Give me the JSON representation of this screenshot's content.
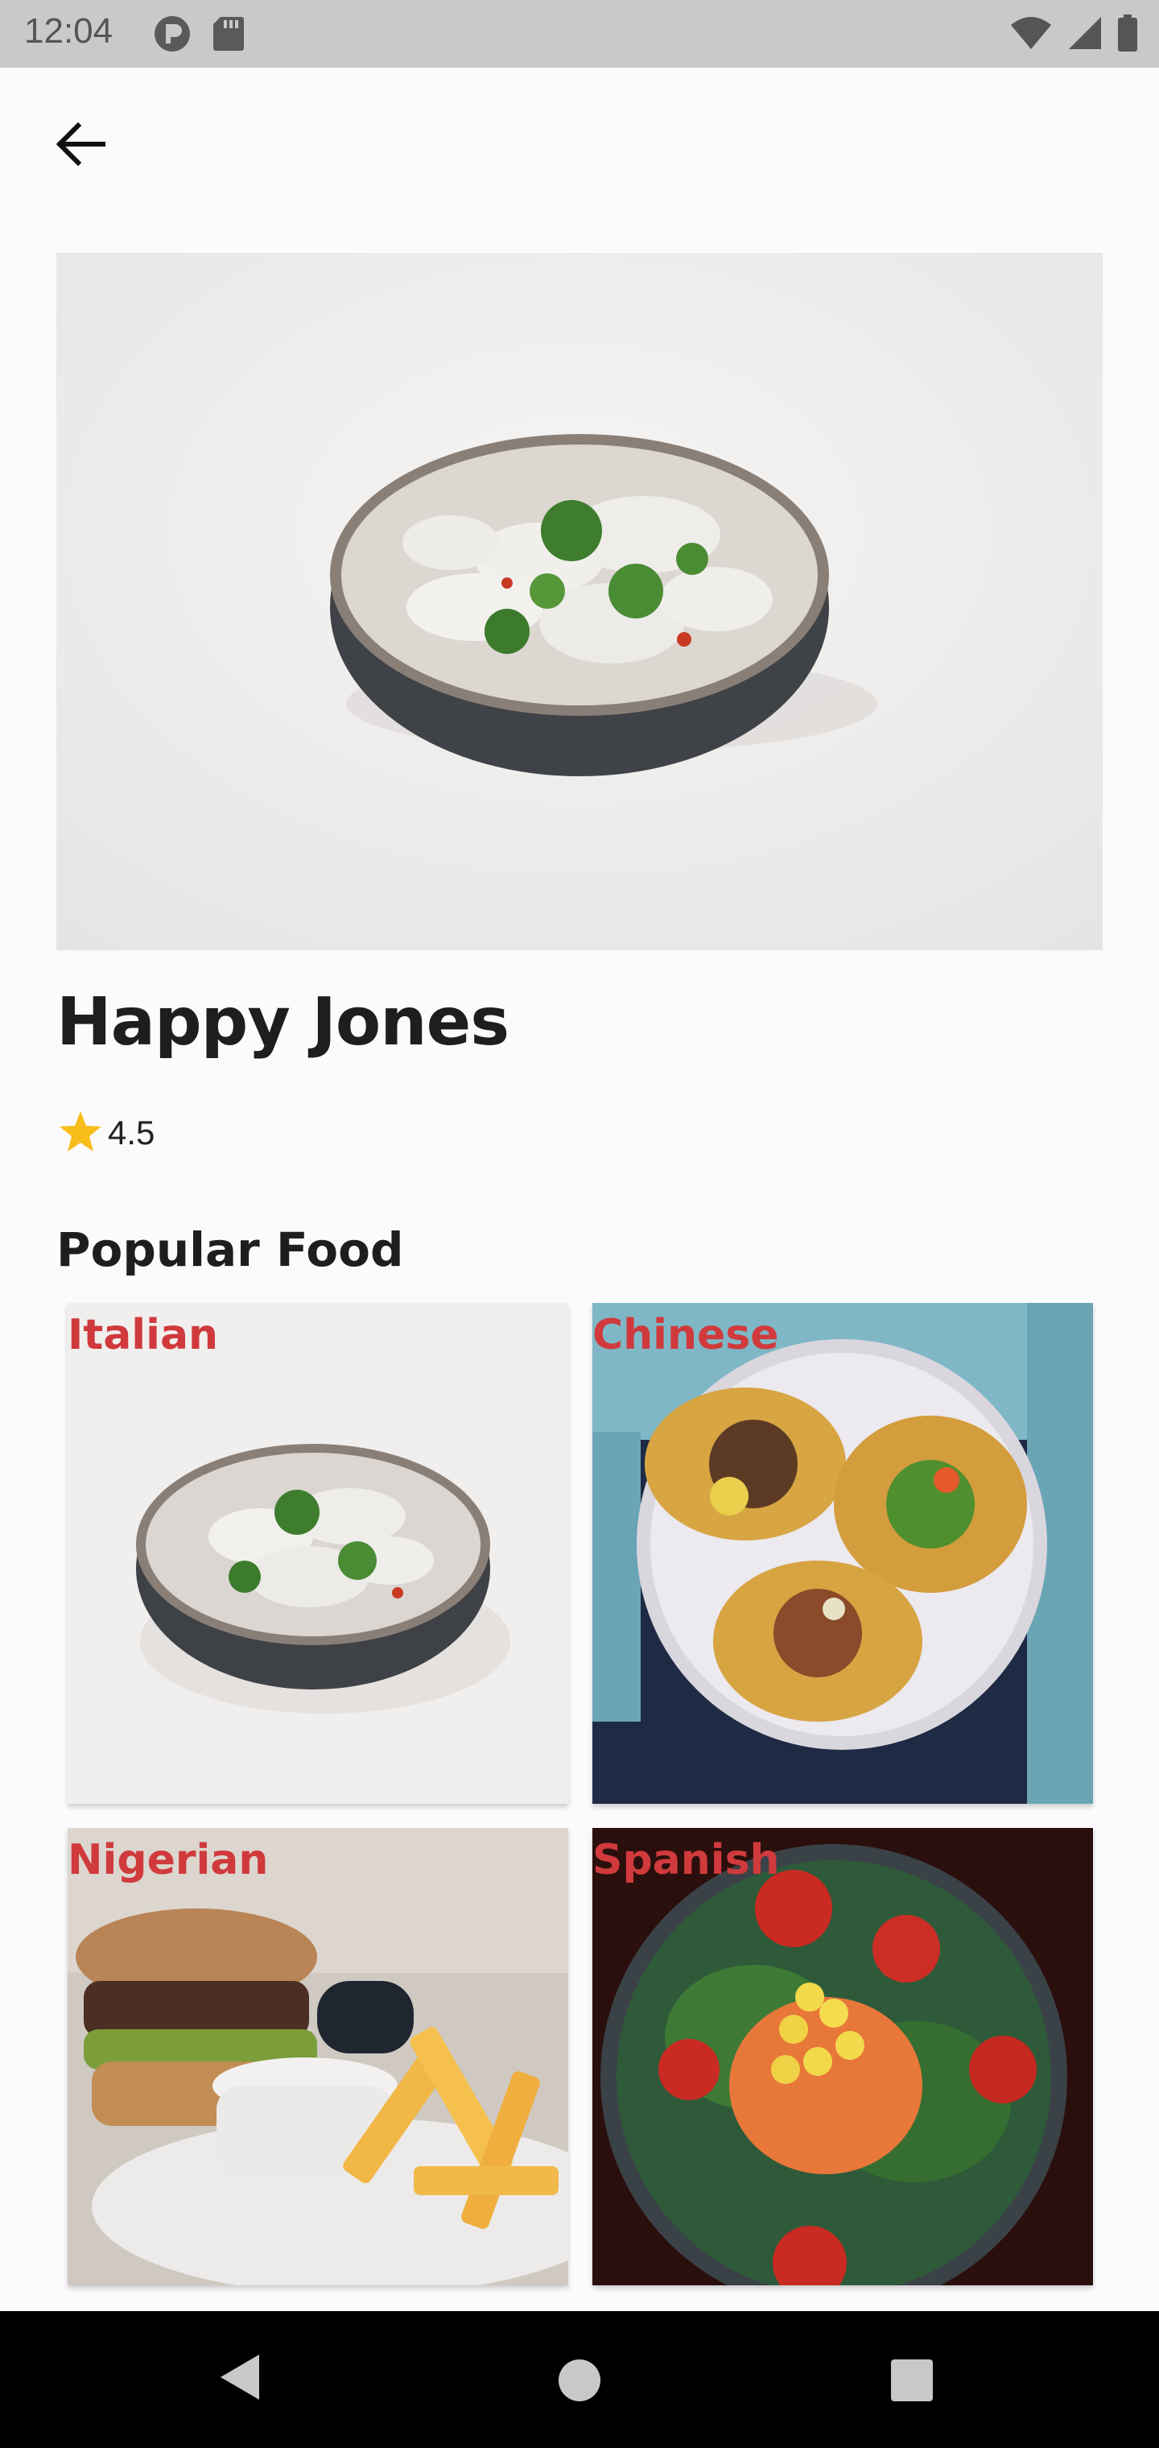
{
  "status_bar": {
    "time": "12:04",
    "left_icons": [
      "p-badge-icon",
      "sd-card-icon"
    ],
    "right_icons": [
      "wifi-icon",
      "signal-icon",
      "battery-icon"
    ]
  },
  "restaurant": {
    "name": "Happy Jones",
    "rating": "4.5",
    "rating_icon": "star-icon",
    "star_color": "#f7bd1a"
  },
  "popular_food": {
    "title": "Popular Food",
    "label_color": "#d03a3c",
    "items": [
      {
        "label": "Italian"
      },
      {
        "label": "Chinese"
      },
      {
        "label": "Nigerian"
      },
      {
        "label": "Spanish"
      }
    ]
  },
  "nav_bar": {
    "icons": [
      "nav-back-icon",
      "nav-home-icon",
      "nav-recents-icon"
    ]
  }
}
